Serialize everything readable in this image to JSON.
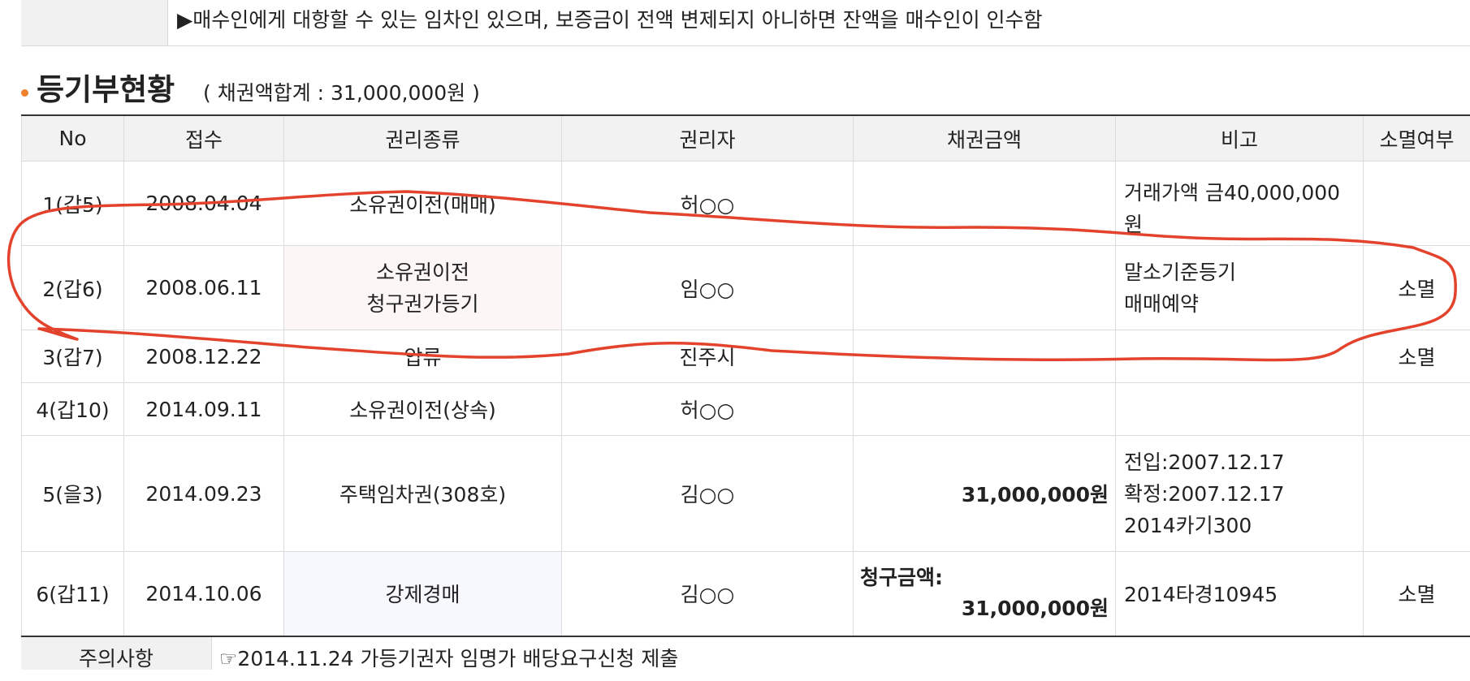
{
  "notice": {
    "text": "▶매수인에게 대항할 수 있는 임차인 있으며, 보증금이 전액 변제되지 아니하면 잔액을 매수인이 인수함"
  },
  "section": {
    "title": "등기부현황",
    "subtitle": "( 채권액합계 : 31,000,000원 )"
  },
  "table": {
    "headers": [
      "No",
      "접수",
      "권리종류",
      "권리자",
      "채권금액",
      "비고",
      "소멸여부"
    ],
    "rows": [
      {
        "no": "1(갑5)",
        "date": "2008.04.04",
        "kind": "소유권이전(매매)",
        "holder": "허○○",
        "amount": "",
        "note_lines": [
          "거래가액 금40,000,000",
          "원"
        ],
        "status": ""
      },
      {
        "no": "2(갑6)",
        "date": "2008.06.11",
        "kind_lines": [
          "소유권이전",
          "청구권가등기"
        ],
        "holder": "임○○",
        "amount": "",
        "note_lines": [
          "말소기준등기",
          "매매예약"
        ],
        "status": "소멸"
      },
      {
        "no": "3(갑7)",
        "date": "2008.12.22",
        "kind": "압류",
        "holder": "진주시",
        "amount": "",
        "note_lines": [],
        "status": "소멸"
      },
      {
        "no": "4(갑10)",
        "date": "2014.09.11",
        "kind": "소유권이전(상속)",
        "holder": "허○○",
        "amount": "",
        "note_lines": [],
        "status": ""
      },
      {
        "no": "5(을3)",
        "date": "2014.09.23",
        "kind": "주택임차권(308호)",
        "holder": "김○○",
        "amount": "31,000,000원",
        "note_lines": [
          "전입:2007.12.17",
          "확정:2007.12.17",
          "2014카기300"
        ],
        "status": ""
      },
      {
        "no": "6(갑11)",
        "date": "2014.10.06",
        "kind": "강제경매",
        "holder": "김○○",
        "amount_label": "청구금액:",
        "amount": "31,000,000원",
        "note_lines": [
          "2014타경10945"
        ],
        "status": "소멸"
      }
    ]
  },
  "caution": {
    "label": "주의사항",
    "text": "☞2014.11.24 가등기권자 임명가 배당요구신청 제출"
  },
  "annotation": {
    "color": "#e3432c"
  }
}
